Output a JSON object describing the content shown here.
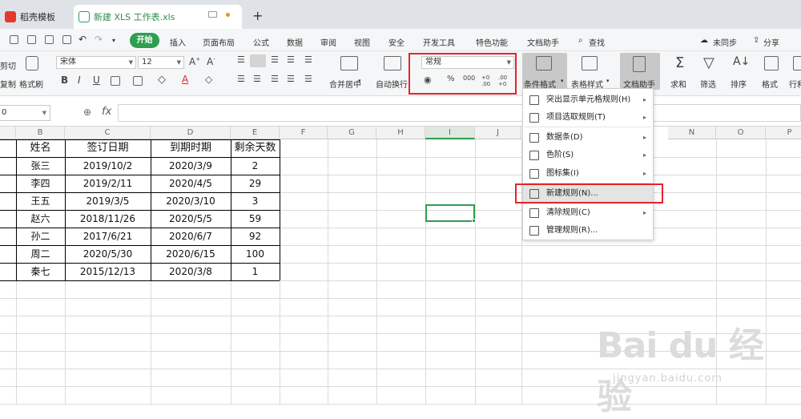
{
  "tabs": {
    "docer": "稻壳模板",
    "workbook": "新建 XLS 工作表.xls",
    "new_tab": "+"
  },
  "menubar": {
    "start": "开始",
    "items": [
      "插入",
      "页面布局",
      "公式",
      "数据",
      "审阅",
      "视图",
      "安全",
      "开发工具",
      "特色功能",
      "文档助手"
    ],
    "search": "查找",
    "sync": "未同步",
    "share": "分享"
  },
  "ribbon": {
    "cut": "剪切",
    "copy": "复制",
    "format_painter": "格式刷",
    "font_name": "宋体",
    "font_size": "12",
    "bold": "B",
    "italic": "I",
    "underline": "U",
    "merge": "合并居中",
    "wrap": "自动换行",
    "number_format": "常规",
    "percent": "%",
    "thousands": "000",
    "inc_dec": "+0 .00",
    "dec_dec": ".00 +0",
    "conditional_format": "条件格式",
    "table_style": "表格样式",
    "doc_assistant": "文档助手",
    "sum": "求和",
    "filter": "筛选",
    "sort": "排序",
    "format": "格式",
    "row": "行和"
  },
  "formula_bar": {
    "name_box": "0",
    "fx": "fx"
  },
  "columns": [
    "B",
    "C",
    "D",
    "E",
    "F",
    "G",
    "H",
    "I",
    "J",
    "N",
    "O",
    "P"
  ],
  "selected_column": "I",
  "table": {
    "headers": [
      "姓名",
      "签订日期",
      "到期时期",
      "剩余天数"
    ],
    "rows": [
      [
        "张三",
        "2019/10/2",
        "2020/3/9",
        "2"
      ],
      [
        "李四",
        "2019/2/11",
        "2020/4/5",
        "29"
      ],
      [
        "王五",
        "2019/3/5",
        "2020/3/10",
        "3"
      ],
      [
        "赵六",
        "2018/11/26",
        "2020/5/5",
        "59"
      ],
      [
        "孙二",
        "2017/6/21",
        "2020/6/7",
        "92"
      ],
      [
        "周二",
        "2020/5/30",
        "2020/6/15",
        "100"
      ],
      [
        "秦七",
        "2015/12/13",
        "2020/3/8",
        "1"
      ]
    ]
  },
  "dropdown": {
    "items": [
      {
        "label": "突出显示单元格规则(H)",
        "arrow": "▸"
      },
      {
        "label": "项目选取规则(T)",
        "arrow": "▸"
      },
      {
        "label": "数据条(D)",
        "arrow": "▸"
      },
      {
        "label": "色阶(S)",
        "arrow": "▸"
      },
      {
        "label": "图标集(I)",
        "arrow": "▸"
      },
      {
        "label": "新建规则(N)...",
        "arrow": ""
      },
      {
        "label": "清除规则(C)",
        "arrow": "▸"
      },
      {
        "label": "管理规则(R)...",
        "arrow": ""
      }
    ]
  },
  "watermark": {
    "brand": "Bai du 经验",
    "url": "jingyan.baidu.com"
  },
  "colors": {
    "accent": "#2e9e4f",
    "highlight": "#e5232b"
  }
}
